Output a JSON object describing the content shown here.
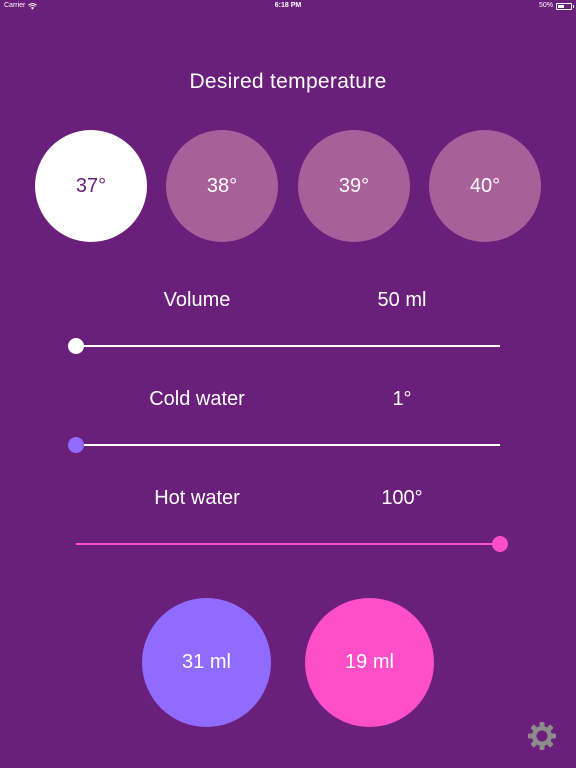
{
  "status_bar": {
    "carrier": "Carrier",
    "time": "6:18 PM",
    "battery": "50%"
  },
  "colors": {
    "background": "#6a1f7a",
    "unselected_circle": "#a8609a",
    "selected_circle": "#ffffff",
    "cold_accent": "#8f6bff",
    "hot_accent": "#ff4fc8",
    "settings_gear": "#8c8c8c"
  },
  "title": "Desired temperature",
  "temperatures": [
    {
      "label": "37°",
      "selected": true
    },
    {
      "label": "38°",
      "selected": false
    },
    {
      "label": "39°",
      "selected": false
    },
    {
      "label": "40°",
      "selected": false
    }
  ],
  "volume": {
    "label": "Volume",
    "value": "50 ml",
    "fraction": 0.0
  },
  "cold_water": {
    "label": "Cold water",
    "value": "1°",
    "fraction": 0.0
  },
  "hot_water": {
    "label": "Hot water",
    "value": "100°",
    "fraction": 1.0
  },
  "results": {
    "cold_amount": "31 ml",
    "hot_amount": "19 ml"
  },
  "icons": {
    "settings": "gear-icon",
    "wifi": "wifi-icon",
    "battery": "battery-icon"
  }
}
